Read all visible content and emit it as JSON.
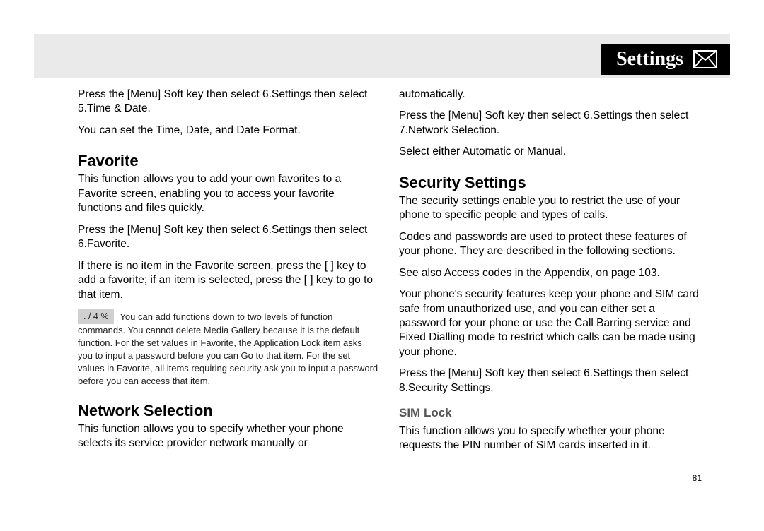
{
  "header": {
    "title": "Settings",
    "icon": "envelope-icon"
  },
  "page_number": "81",
  "left": {
    "intro1": "Press the [Menu] Soft key then select 6.Settings then select 5.Time & Date.",
    "intro2": "You can set the Time, Date, and Date Format.",
    "favorite": {
      "heading": "Favorite",
      "p1": "This function allows you to add your own favorites to a Favorite screen, enabling you to access your favorite functions and files quickly.",
      "p2": "Press the [Menu] Soft key then select 6.Settings then select 6.Favorite.",
      "p3": "If there is no item in the Favorite screen, press the [      ] key to add a favorite; if an item is selected, press the [      ] key to go to that item.",
      "note_label": ". / 4 %",
      "note_body": "You can add functions down to two levels of function commands. You cannot delete Media Gallery because it is the default function. For the set values in Favorite, the Application Lock item asks you to input a password before you can Go to that item. For the set values in Favorite, all items requiring security ask you to input a password before you can access that item."
    },
    "network": {
      "heading": "Network Selection",
      "p1": "This function allows you to specify whether your phone selects its service provider network manually or"
    }
  },
  "right": {
    "cont1": "automatically.",
    "cont2": "Press the [Menu] Soft key then select 6.Settings then select 7.Network Selection.",
    "cont3": "Select either Automatic or Manual.",
    "security": {
      "heading": "Security Settings",
      "p1": "The security settings enable you to restrict the use of your phone to specific people and types of calls.",
      "p2": "Codes and passwords are used to protect these features of your phone. They are described in the following sections.",
      "p3": "See also Access codes in the Appendix, on page 103.",
      "p4": "Your phone's security features keep your phone and SIM card safe from unauthorized use, and you can either set a password for your phone or use the Call Barring service and Fixed Dialling mode to restrict which calls can be made using your phone.",
      "p5": "Press the [Menu] Soft key then select 6.Settings then select 8.Security Settings."
    },
    "simlock": {
      "heading": "SIM Lock",
      "p1": "This function allows you to specify whether your phone requests the PIN number of SIM cards inserted in it."
    }
  }
}
